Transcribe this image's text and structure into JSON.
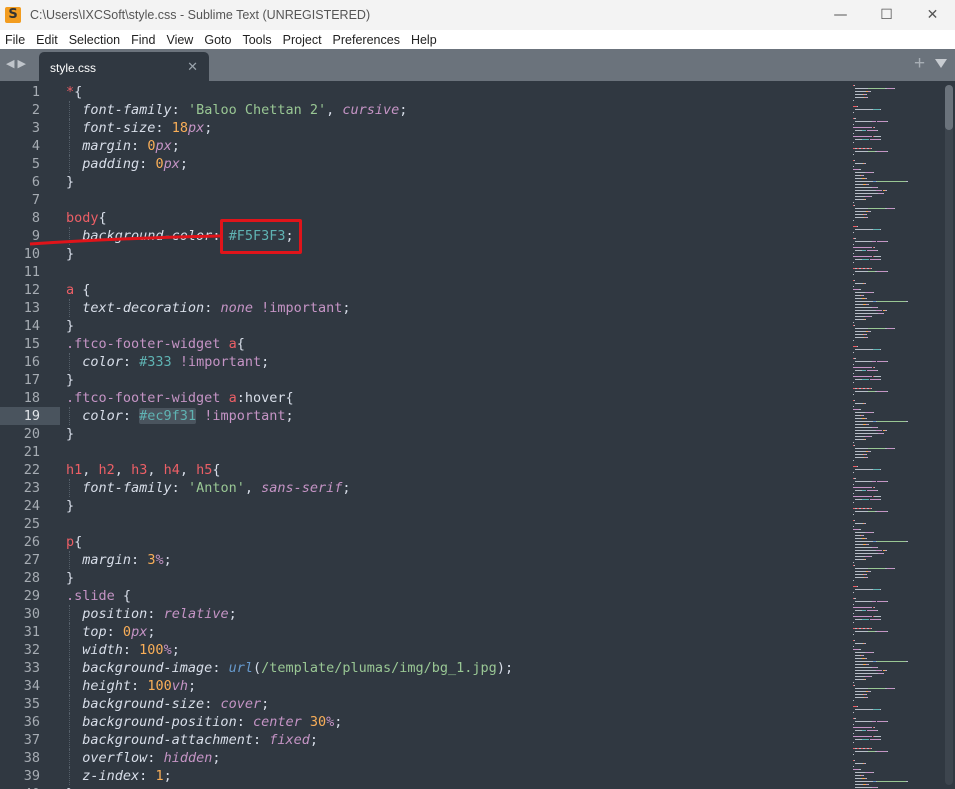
{
  "window": {
    "title": "C:\\Users\\IXCSoft\\style.css - Sublime Text (UNREGISTERED)",
    "app_icon": "S"
  },
  "menu": [
    "File",
    "Edit",
    "Selection",
    "Find",
    "View",
    "Goto",
    "Tools",
    "Project",
    "Preferences",
    "Help"
  ],
  "tab": {
    "label": "style.css"
  },
  "colors": {
    "background": "#303841",
    "selector": "#ec5f66",
    "string": "#99c794",
    "number": "#f9ae58",
    "keyword": "#c594c5",
    "hex": "#5fb3b3",
    "annotation": "#e0141a"
  },
  "current_line": 19,
  "lines": [
    [
      [
        "t-sel",
        "*"
      ],
      [
        "t-pun",
        "{"
      ]
    ],
    [
      [
        "t-pun",
        "  "
      ],
      [
        "t-prop",
        "font-family"
      ],
      [
        "t-pun",
        ": "
      ],
      [
        "t-str",
        "'Baloo Chettan 2'"
      ],
      [
        "t-pun",
        ", "
      ],
      [
        "t-kw",
        "cursive"
      ],
      [
        "t-pun",
        ";"
      ]
    ],
    [
      [
        "t-pun",
        "  "
      ],
      [
        "t-prop",
        "font-size"
      ],
      [
        "t-pun",
        ": "
      ],
      [
        "t-num",
        "18"
      ],
      [
        "t-unit",
        "px"
      ],
      [
        "t-pun",
        ";"
      ]
    ],
    [
      [
        "t-pun",
        "  "
      ],
      [
        "t-prop",
        "margin"
      ],
      [
        "t-pun",
        ": "
      ],
      [
        "t-num",
        "0"
      ],
      [
        "t-unit",
        "px"
      ],
      [
        "t-pun",
        ";"
      ]
    ],
    [
      [
        "t-pun",
        "  "
      ],
      [
        "t-prop",
        "padding"
      ],
      [
        "t-pun",
        ": "
      ],
      [
        "t-num",
        "0"
      ],
      [
        "t-unit",
        "px"
      ],
      [
        "t-pun",
        ";"
      ]
    ],
    [
      [
        "t-pun",
        "}"
      ]
    ],
    [],
    [
      [
        "t-sel",
        "body"
      ],
      [
        "t-pun",
        "{"
      ]
    ],
    [
      [
        "t-pun",
        "  "
      ],
      [
        "t-prop",
        "background-color"
      ],
      [
        "t-pun",
        ": "
      ],
      [
        "t-hex",
        "#F5F3F3"
      ],
      [
        "t-pun",
        ";"
      ]
    ],
    [
      [
        "t-pun",
        "}"
      ]
    ],
    [],
    [
      [
        "t-sel",
        "a"
      ],
      [
        "t-pun",
        " {"
      ]
    ],
    [
      [
        "t-pun",
        "  "
      ],
      [
        "t-prop",
        "text-decoration"
      ],
      [
        "t-pun",
        ": "
      ],
      [
        "t-kw",
        "none"
      ],
      [
        "t-pun",
        " "
      ],
      [
        "t-imp",
        "!important"
      ],
      [
        "t-pun",
        ";"
      ]
    ],
    [
      [
        "t-pun",
        "}"
      ]
    ],
    [
      [
        "t-cls",
        ".ftco-footer-widget"
      ],
      [
        "t-pun",
        " "
      ],
      [
        "t-sel",
        "a"
      ],
      [
        "t-pun",
        "{"
      ]
    ],
    [
      [
        "t-pun",
        "  "
      ],
      [
        "t-prop",
        "color"
      ],
      [
        "t-pun",
        ": "
      ],
      [
        "t-hex",
        "#333"
      ],
      [
        "t-pun",
        " "
      ],
      [
        "t-imp",
        "!important"
      ],
      [
        "t-pun",
        ";"
      ]
    ],
    [
      [
        "t-pun",
        "}"
      ]
    ],
    [
      [
        "t-cls",
        ".ftco-footer-widget"
      ],
      [
        "t-pun",
        " "
      ],
      [
        "t-sel",
        "a"
      ],
      [
        "t-pun",
        ":hover{"
      ]
    ],
    [
      [
        "t-pun",
        "  "
      ],
      [
        "t-prop",
        "color"
      ],
      [
        "t-pun",
        ": "
      ],
      [
        "t-hexsel",
        "#ec9f31"
      ],
      [
        "t-pun",
        " "
      ],
      [
        "t-imp",
        "!important"
      ],
      [
        "t-pun",
        ";"
      ]
    ],
    [
      [
        "t-pun",
        "}"
      ]
    ],
    [],
    [
      [
        "t-sel",
        "h1"
      ],
      [
        "t-pun",
        ", "
      ],
      [
        "t-sel",
        "h2"
      ],
      [
        "t-pun",
        ", "
      ],
      [
        "t-sel",
        "h3"
      ],
      [
        "t-pun",
        ", "
      ],
      [
        "t-sel",
        "h4"
      ],
      [
        "t-pun",
        ", "
      ],
      [
        "t-sel",
        "h5"
      ],
      [
        "t-pun",
        "{"
      ]
    ],
    [
      [
        "t-pun",
        "  "
      ],
      [
        "t-prop",
        "font-family"
      ],
      [
        "t-pun",
        ": "
      ],
      [
        "t-str",
        "'Anton'"
      ],
      [
        "t-pun",
        ", "
      ],
      [
        "t-kw",
        "sans-serif"
      ],
      [
        "t-pun",
        ";"
      ]
    ],
    [
      [
        "t-pun",
        "}"
      ]
    ],
    [],
    [
      [
        "t-sel",
        "p"
      ],
      [
        "t-pun",
        "{"
      ]
    ],
    [
      [
        "t-pun",
        "  "
      ],
      [
        "t-prop",
        "margin"
      ],
      [
        "t-pun",
        ": "
      ],
      [
        "t-num",
        "3"
      ],
      [
        "t-unit",
        "%"
      ],
      [
        "t-pun",
        ";"
      ]
    ],
    [
      [
        "t-pun",
        "}"
      ]
    ],
    [
      [
        "t-cls",
        ".slide"
      ],
      [
        "t-pun",
        " {"
      ]
    ],
    [
      [
        "t-pun",
        "  "
      ],
      [
        "t-prop",
        "position"
      ],
      [
        "t-pun",
        ": "
      ],
      [
        "t-kw",
        "relative"
      ],
      [
        "t-pun",
        ";"
      ]
    ],
    [
      [
        "t-pun",
        "  "
      ],
      [
        "t-prop",
        "top"
      ],
      [
        "t-pun",
        ": "
      ],
      [
        "t-num",
        "0"
      ],
      [
        "t-unit",
        "px"
      ],
      [
        "t-pun",
        ";"
      ]
    ],
    [
      [
        "t-pun",
        "  "
      ],
      [
        "t-prop",
        "width"
      ],
      [
        "t-pun",
        ": "
      ],
      [
        "t-num",
        "100"
      ],
      [
        "t-unit",
        "%"
      ],
      [
        "t-pun",
        ";"
      ]
    ],
    [
      [
        "t-pun",
        "  "
      ],
      [
        "t-prop",
        "background-image"
      ],
      [
        "t-pun",
        ": "
      ],
      [
        "t-fn",
        "url"
      ],
      [
        "t-pun",
        "("
      ],
      [
        "t-str",
        "/template/plumas/img/bg_1.jpg"
      ],
      [
        "t-pun",
        ");"
      ]
    ],
    [
      [
        "t-pun",
        "  "
      ],
      [
        "t-prop",
        "height"
      ],
      [
        "t-pun",
        ": "
      ],
      [
        "t-num",
        "100"
      ],
      [
        "t-unit",
        "vh"
      ],
      [
        "t-pun",
        ";"
      ]
    ],
    [
      [
        "t-pun",
        "  "
      ],
      [
        "t-prop",
        "background-size"
      ],
      [
        "t-pun",
        ": "
      ],
      [
        "t-kw",
        "cover"
      ],
      [
        "t-pun",
        ";"
      ]
    ],
    [
      [
        "t-pun",
        "  "
      ],
      [
        "t-prop",
        "background-position"
      ],
      [
        "t-pun",
        ": "
      ],
      [
        "t-kw",
        "center"
      ],
      [
        "t-pun",
        " "
      ],
      [
        "t-num",
        "30"
      ],
      [
        "t-unit",
        "%"
      ],
      [
        "t-pun",
        ";"
      ]
    ],
    [
      [
        "t-pun",
        "  "
      ],
      [
        "t-prop",
        "background-attachment"
      ],
      [
        "t-pun",
        ": "
      ],
      [
        "t-kw",
        "fixed"
      ],
      [
        "t-pun",
        ";"
      ]
    ],
    [
      [
        "t-pun",
        "  "
      ],
      [
        "t-prop",
        "overflow"
      ],
      [
        "t-pun",
        ": "
      ],
      [
        "t-kw",
        "hidden"
      ],
      [
        "t-pun",
        ";"
      ]
    ],
    [
      [
        "t-pun",
        "  "
      ],
      [
        "t-prop",
        "z-index"
      ],
      [
        "t-pun",
        ": "
      ],
      [
        "t-num",
        "1"
      ],
      [
        "t-pun",
        ";"
      ]
    ],
    [
      [
        "t-pun",
        "}"
      ]
    ]
  ]
}
